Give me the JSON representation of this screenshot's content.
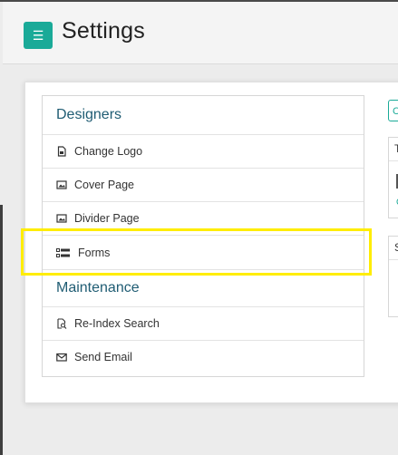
{
  "header": {
    "menu_icon": "☰",
    "title": "Settings"
  },
  "designers": {
    "heading": "Designers",
    "items": [
      {
        "label": "Change Logo",
        "icon": "file-image-icon"
      },
      {
        "label": "Cover Page",
        "icon": "image-icon"
      },
      {
        "label": "Divider Page",
        "icon": "image-icon"
      },
      {
        "label": "Forms",
        "icon": "form-list-icon"
      }
    ]
  },
  "maintenance": {
    "heading": "Maintenance",
    "items": [
      {
        "label": "Re-Index Search",
        "icon": "search-file-icon"
      },
      {
        "label": "Send Email",
        "icon": "envelope-icon"
      }
    ]
  },
  "right": {
    "button_text": "C",
    "panel_a_header": "T",
    "panel_a_link": "C",
    "panel_b_header": "S"
  },
  "colors": {
    "accent": "#1aaa98",
    "section_heading": "#1f5c73",
    "highlight": "#ffed00"
  }
}
